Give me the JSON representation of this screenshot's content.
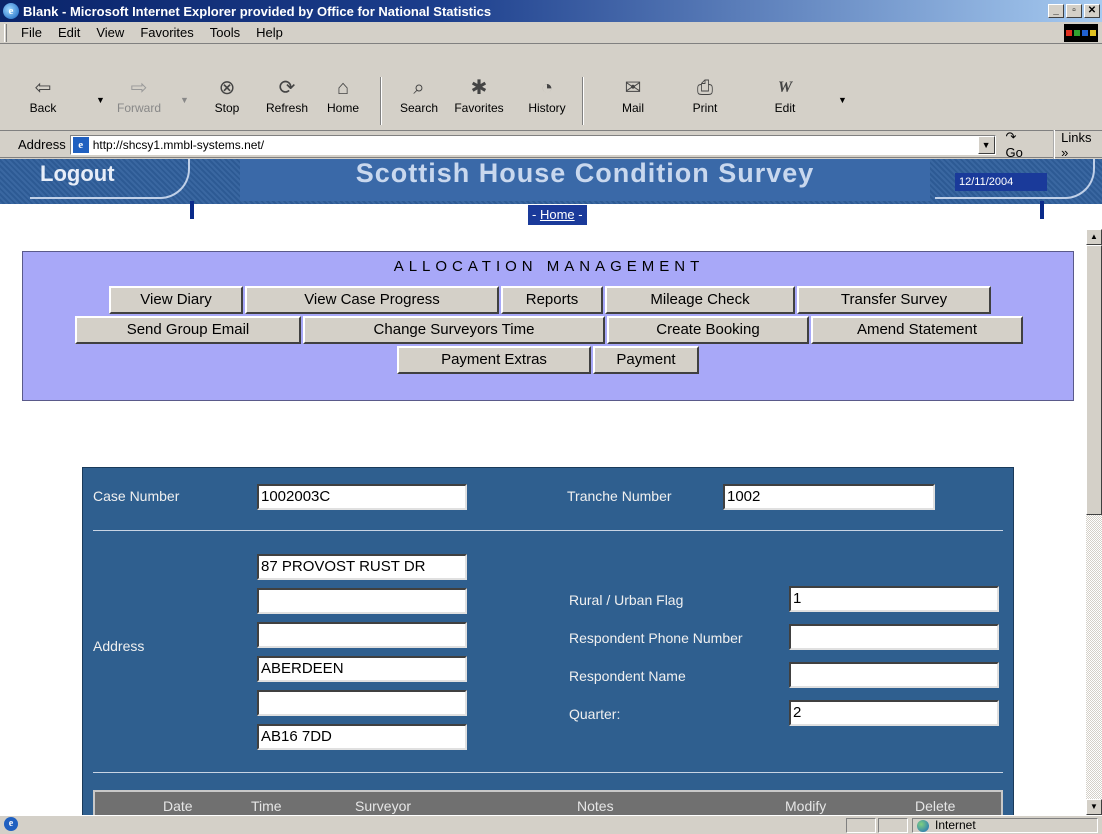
{
  "window": {
    "title": "Blank - Microsoft Internet Explorer provided by Office for National Statistics",
    "controls": [
      "_",
      "▫",
      "✕"
    ]
  },
  "menu": [
    "File",
    "Edit",
    "View",
    "Favorites",
    "Tools",
    "Help"
  ],
  "toolbar": {
    "back": "Back",
    "forward": "Forward",
    "stop": "Stop",
    "refresh": "Refresh",
    "home": "Home",
    "search": "Search",
    "favorites": "Favorites",
    "history": "History",
    "mail": "Mail",
    "print": "Print",
    "edit": "Edit"
  },
  "address": {
    "label": "Address",
    "url": "http://shcsy1.mmbl-systems.net/",
    "go": "Go",
    "links": "Links"
  },
  "site": {
    "logout": "Logout",
    "title": "Scottish House Condition Survey",
    "home_link": "Home",
    "home_left_dash": "- ",
    "home_right_dash": " -",
    "date": "12/11/2004"
  },
  "allocation": {
    "title": "ALLOCATION MANAGEMENT",
    "buttons": {
      "view_diary": "View Diary",
      "view_case_progress": "View Case Progress",
      "reports": "Reports",
      "mileage_check": "Mileage Check",
      "transfer_survey": "Transfer Survey",
      "send_group_email": "Send Group Email",
      "change_surveyors_time": "Change Surveyors Time",
      "create_booking": "Create Booking",
      "amend_statement": "Amend Statement",
      "payment_extras": "Payment Extras",
      "payment": "Payment"
    }
  },
  "case": {
    "case_number_label": "Case Number",
    "case_number": "1002003C",
    "tranche_number_label": "Tranche Number",
    "tranche_number": "1002",
    "address_label": "Address",
    "address_lines": [
      "87 PROVOST RUST DR",
      "",
      "",
      "ABERDEEN",
      "",
      "AB16 7DD"
    ],
    "rural_urban_label": "Rural / Urban Flag",
    "rural_urban": "1",
    "phone_label": "Respondent Phone Number",
    "phone": "",
    "name_label": "Respondent Name",
    "name": "",
    "quarter_label": "Quarter:",
    "quarter": "2"
  },
  "grid": {
    "columns": [
      "Date",
      "Time",
      "Surveyor",
      "Notes",
      "Modify",
      "Delete"
    ]
  },
  "status": {
    "zone": "Internet"
  },
  "colors": {
    "title_bar": "#0a246a",
    "panel_bg": "#a8a8f8",
    "form_bg": "#2f5f8f",
    "header_band": "#2f5f9c"
  }
}
